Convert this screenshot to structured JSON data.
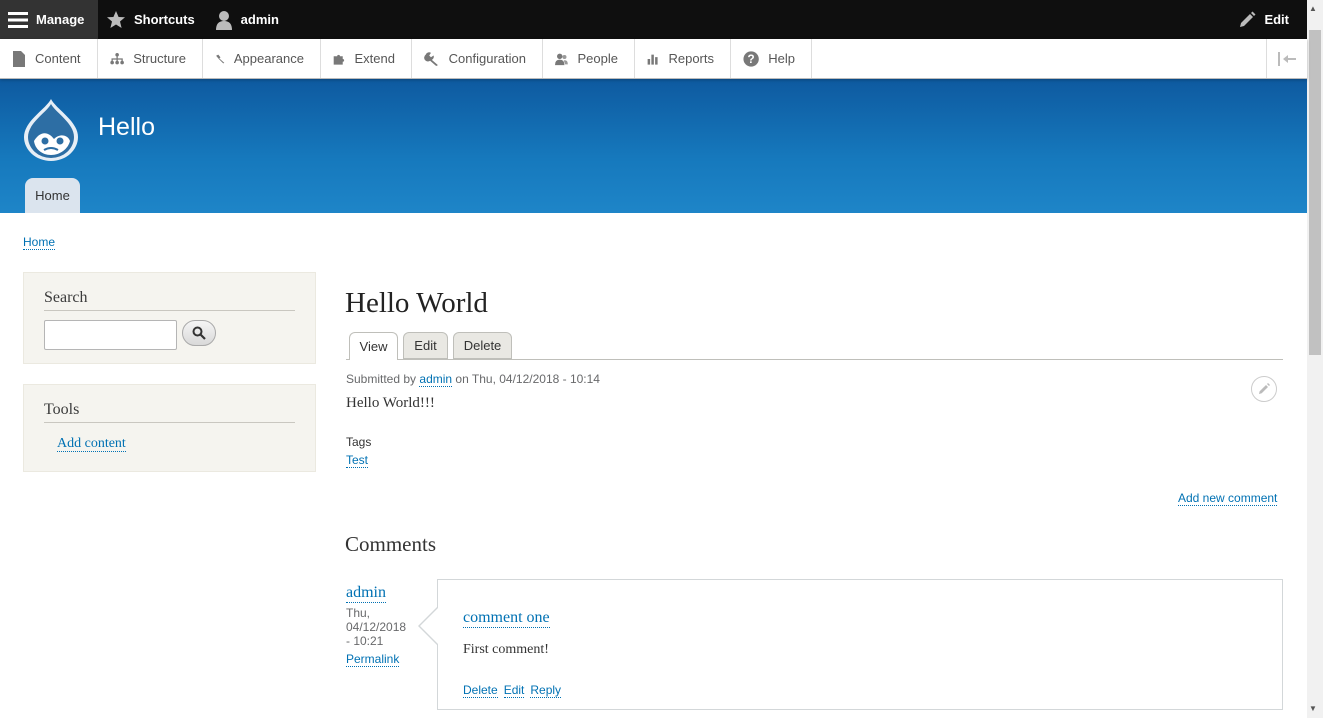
{
  "toolbar": {
    "manage": "Manage",
    "shortcuts": "Shortcuts",
    "user": "admin",
    "edit": "Edit"
  },
  "admin_menu": {
    "items": [
      {
        "label": "Content",
        "icon": "file-icon"
      },
      {
        "label": "Structure",
        "icon": "sitemap-icon"
      },
      {
        "label": "Appearance",
        "icon": "paintbrush-icon"
      },
      {
        "label": "Extend",
        "icon": "puzzle-icon"
      },
      {
        "label": "Configuration",
        "icon": "wrench-icon"
      },
      {
        "label": "People",
        "icon": "people-icon"
      },
      {
        "label": "Reports",
        "icon": "bar-chart-icon"
      },
      {
        "label": "Help",
        "icon": "question-icon"
      }
    ]
  },
  "header": {
    "site_name": "Hello",
    "home_tab": "Home"
  },
  "breadcrumb": {
    "home": "Home"
  },
  "sidebar": {
    "search_title": "Search",
    "search_placeholder": "",
    "tools_title": "Tools",
    "add_content": "Add content"
  },
  "node": {
    "title": "Hello World",
    "tabs": [
      "View",
      "Edit",
      "Delete"
    ],
    "submitted_prefix": "Submitted by",
    "author": "admin",
    "submitted_date": "on Thu, 04/12/2018 - 10:14",
    "body": "Hello World!!!",
    "tags_label": "Tags",
    "tag": "Test",
    "add_comment": "Add new comment"
  },
  "comments": {
    "title": "Comments",
    "items": [
      {
        "author": "admin",
        "date_line1": "Thu,",
        "date_line2": "04/12/2018",
        "date_line3": "- 10:21",
        "permalink": "Permalink",
        "subject": "comment one",
        "body": "First comment!",
        "links": [
          "Delete",
          "Edit",
          "Reply"
        ]
      }
    ]
  },
  "colors": {
    "link": "#0071b3",
    "header_top": "#0e5aa0",
    "header_bottom": "#1e85c8",
    "toolbar": "#0f0f0f"
  }
}
